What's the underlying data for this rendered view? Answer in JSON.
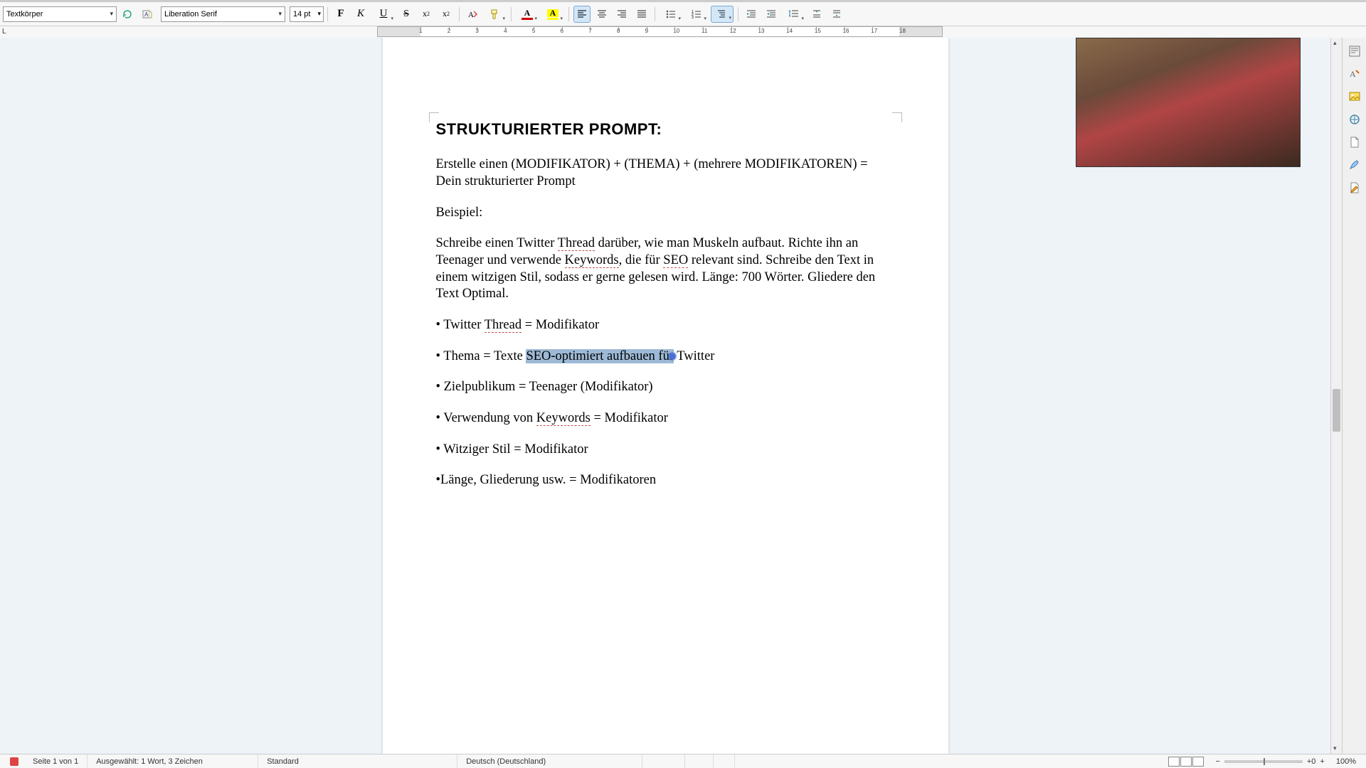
{
  "toolbar": {
    "para_style": "Textkörper",
    "font_name": "Liberation Serif",
    "font_size": "14 pt",
    "bold": "F",
    "italic": "K",
    "underline": "U",
    "strike": "S",
    "super": "x²",
    "sub": "x₂",
    "fontcolor_letter": "A",
    "highlight_letter": "A"
  },
  "doc": {
    "heading": "STRUKTURIERTER PROMPT:",
    "p1": "Erstelle einen (MODIFIKATOR) + (THEMA) + (mehrere MODIFIKATOREN) = Dein strukturierter Prompt",
    "p2": "Beispiel:",
    "p3a": "Schreibe einen Twitter ",
    "p3_thread": "Thread",
    "p3b": " darüber, wie man Muskeln aufbaut. Richte ihn an Teenager und verwende ",
    "p3_kw": "Keywords",
    "p3c": ", die für ",
    "p3_seo": "SEO",
    "p3d": " relevant sind. Schreibe den Text in einem witzigen Stil, sodass er gerne gelesen wird. Länge: 700 Wörter. Gliedere den Text Optimal.",
    "b1a": "• Twitter ",
    "b1_thread": "Thread",
    "b1b": " = Modifikator",
    "b2a": "• Thema = Texte ",
    "b2_sel": "SEO-optimiert aufbauen für",
    "b2b": " Twitter",
    "b3": "• Zielpublikum = Teenager (Modifikator)",
    "b4a": "• Verwendung von ",
    "b4_kw": "Keywords",
    "b4b": " = Modifikator",
    "b5": "• Witziger Stil = Modifikator",
    "b6": "•Länge, Gliederung usw. = Modifikatoren"
  },
  "ruler": {
    "tab_char": "L",
    "numbers": [
      1,
      2,
      3,
      4,
      5,
      6,
      7,
      8,
      9,
      10,
      11,
      12,
      13,
      14,
      15,
      16,
      17,
      18
    ]
  },
  "status": {
    "page": "Seite 1 von 1",
    "selection": "Ausgewählt: 1 Wort, 3 Zeichen",
    "style": "Standard",
    "lang": "Deutsch (Deutschland)",
    "zoom_center": "+0",
    "zoom_minus": "−",
    "zoom_plus": "+",
    "zoom_pct": "100%"
  },
  "icons": {
    "update": "update-style",
    "new_style": "new-style",
    "align_left": "align-left",
    "align_center": "align-center",
    "align_right": "align-right",
    "align_justify": "align-justify",
    "bullets": "bullets",
    "numbering": "numbering",
    "outline": "outline",
    "indent_inc": "indent-increase",
    "indent_dec": "indent-decrease",
    "line_spacing": "line-spacing",
    "para_space_inc": "para-space-inc",
    "para_space_dec": "para-space-dec",
    "clear": "clear-format",
    "char": "char-format"
  }
}
